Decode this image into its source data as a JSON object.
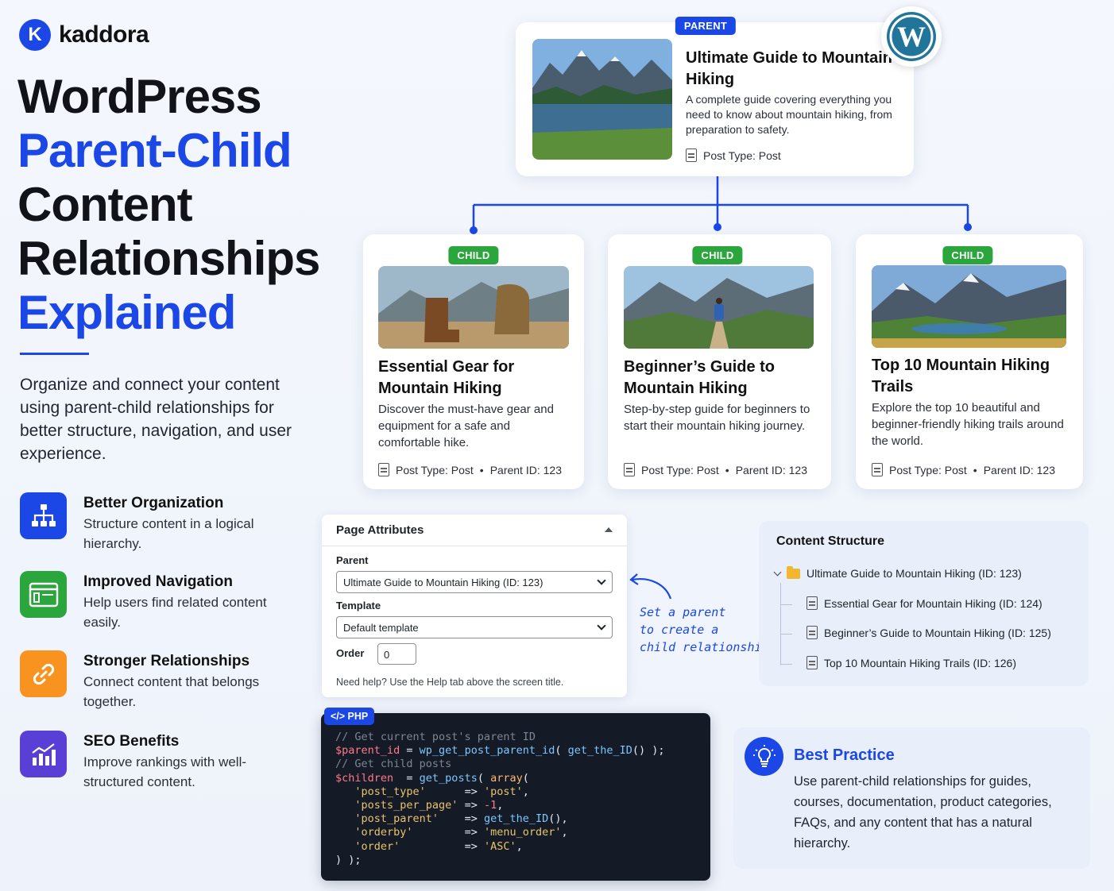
{
  "brand": {
    "name": "kaddora",
    "mark": "K"
  },
  "title": {
    "line1": "WordPress",
    "line2": "Parent-Child",
    "line3": "Content",
    "line4": "Relationships",
    "line5": "Explained"
  },
  "intro": "Organize and connect your content using parent-child relationships for better structure, navigation, and user experience.",
  "features": [
    {
      "title": "Better Organization",
      "desc": "Structure content in a logical hierarchy.",
      "icon": "hierarchy-icon",
      "color": "#1a47e6"
    },
    {
      "title": "Improved Navigation",
      "desc": "Help users find related content easily.",
      "icon": "browser-window-icon",
      "color": "#2ba63c"
    },
    {
      "title": "Stronger Relationships",
      "desc": "Connect content that belongs together.",
      "icon": "link-icon",
      "color": "#f7931e"
    },
    {
      "title": "SEO Benefits",
      "desc": "Improve rankings with well-structured content.",
      "icon": "bar-chart-icon",
      "color": "#5a3fd6"
    }
  ],
  "parent_card": {
    "badge": "PARENT",
    "title": "Ultimate Guide to Mountain Hiking",
    "desc": "A complete guide covering everything you need to know about mountain hiking, from preparation to safety.",
    "meta": "Post Type: Post"
  },
  "child_cards": [
    {
      "badge": "CHILD",
      "title": "Essential Gear for Mountain Hiking",
      "desc": "Discover the must-have gear and equipment for a safe and comfortable hike.",
      "post_type": "Post Type: Post",
      "parent_id": "Parent ID: 123"
    },
    {
      "badge": "CHILD",
      "title": "Beginner’s Guide to Mountain Hiking",
      "desc": "Step-by-step guide for beginners to start their mountain hiking journey.",
      "post_type": "Post Type: Post",
      "parent_id": "Parent ID: 123"
    },
    {
      "badge": "CHILD",
      "title": "Top 10 Mountain Hiking Trails",
      "desc": "Explore the top 10 beautiful and beginner-friendly hiking trails around the world.",
      "post_type": "Post Type: Post",
      "parent_id": "Parent ID: 123"
    }
  ],
  "meta_separator": "•",
  "page_attributes": {
    "heading": "Page Attributes",
    "parent_label": "Parent",
    "parent_value": "Ultimate Guide to Mountain Hiking (ID: 123)",
    "template_label": "Template",
    "template_value": "Default template",
    "order_label": "Order",
    "order_value": "0",
    "help": "Need help? Use the Help tab above the screen title."
  },
  "annotation": {
    "line1": "Set a parent",
    "line2": "to create a",
    "line3": "child relationship"
  },
  "code": {
    "badge": "</> PHP",
    "comment1": "// Get current post's parent ID",
    "comment2": "// Get child posts"
  },
  "content_structure": {
    "title": "Content Structure",
    "root": "Ultimate Guide to Mountain Hiking (ID: 123)",
    "children": [
      "Essential Gear for Mountain Hiking (ID: 124)",
      "Beginner’s Guide to Mountain Hiking (ID: 125)",
      "Top 10 Mountain Hiking Trails (ID: 126)"
    ]
  },
  "best_practice": {
    "title": "Best Practice",
    "text": "Use parent-child relationships for guides, courses, documentation, product categories, FAQs, and any content that has a natural hierarchy."
  },
  "colors": {
    "accent": "#1a47e6",
    "child_green": "#2ba63c",
    "wordpress_blue": "#21759b"
  }
}
